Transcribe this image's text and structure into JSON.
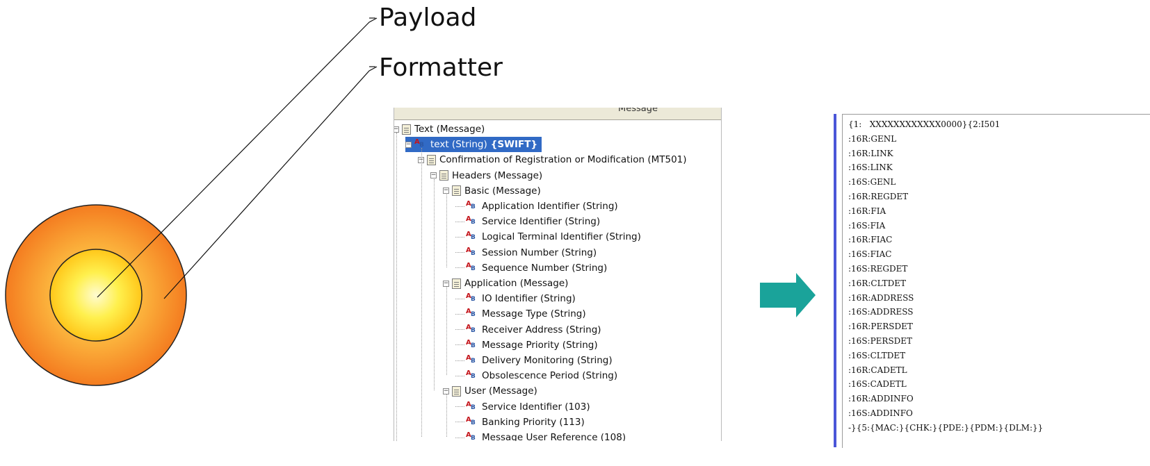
{
  "callouts": {
    "payload": "Payload",
    "formatter": "Formatter"
  },
  "colors": {
    "outer_circle": "#f7941d",
    "inner_circle": "#ffe000",
    "arrow": "#1aa39a",
    "selection": "#316ac5",
    "text_pane_border": "#4a56d8"
  },
  "tree": {
    "header": "Message",
    "rows": [
      {
        "label": "Text (Message)",
        "icon": "message-icon",
        "toggle": "−"
      },
      {
        "label": "text (String)",
        "badge": "{SWIFT}",
        "icon": "string-icon",
        "toggle": "−",
        "selected": true
      },
      {
        "label": "Confirmation of Registration or Modification (MT501)",
        "icon": "message-icon",
        "toggle": "−"
      },
      {
        "label": "Headers (Message)",
        "icon": "message-icon",
        "toggle": "−"
      },
      {
        "label": "Basic (Message)",
        "icon": "message-icon",
        "toggle": "−"
      },
      {
        "label": "Application Identifier (String)",
        "icon": "string-icon"
      },
      {
        "label": "Service Identifier (String)",
        "icon": "string-icon"
      },
      {
        "label": "Logical Terminal Identifier (String)",
        "icon": "string-icon"
      },
      {
        "label": "Session Number (String)",
        "icon": "string-icon"
      },
      {
        "label": "Sequence Number (String)",
        "icon": "string-icon"
      },
      {
        "label": "Application (Message)",
        "icon": "message-icon",
        "toggle": "−"
      },
      {
        "label": "IO Identifier (String)",
        "icon": "string-icon"
      },
      {
        "label": "Message Type (String)",
        "icon": "string-icon"
      },
      {
        "label": "Receiver Address (String)",
        "icon": "string-icon"
      },
      {
        "label": "Message Priority (String)",
        "icon": "string-icon"
      },
      {
        "label": "Delivery Monitoring (String)",
        "icon": "string-icon"
      },
      {
        "label": "Obsolescence Period (String)",
        "icon": "string-icon"
      },
      {
        "label": "User (Message)",
        "icon": "message-icon",
        "toggle": "−"
      },
      {
        "label": "Service Identifier (103)",
        "icon": "string-icon"
      },
      {
        "label": "Banking Priority (113)",
        "icon": "string-icon"
      },
      {
        "label": "Message User Reference (108)",
        "icon": "string-icon"
      }
    ]
  },
  "text_pane": {
    "lines": [
      "{1:   XXXXXXXXXXXX0000}{2:I501",
      ":16R:GENL",
      ":16R:LINK",
      ":16S:LINK",
      ":16S:GENL",
      ":16R:REGDET",
      ":16R:FIA",
      ":16S:FIA",
      ":16R:FIAC",
      ":16S:FIAC",
      ":16S:REGDET",
      ":16R:CLTDET",
      ":16R:ADDRESS",
      ":16S:ADDRESS",
      ":16R:PERSDET",
      ":16S:PERSDET",
      ":16S:CLTDET",
      ":16R:CADETL",
      ":16S:CADETL",
      ":16R:ADDINFO",
      ":16S:ADDINFO",
      "-}{5:{MAC:}{CHK:}{PDE:}{PDM:}{DLM:}}"
    ]
  }
}
